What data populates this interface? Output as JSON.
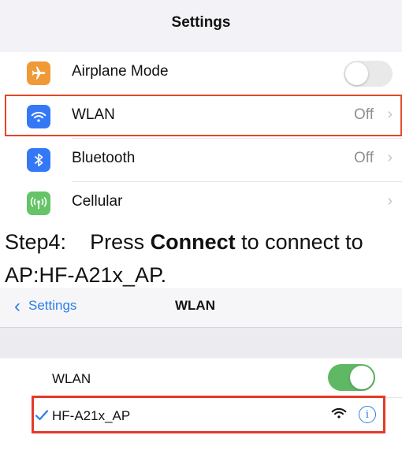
{
  "settings_screen": {
    "title": "Settings",
    "items": [
      {
        "label": "Airplane Mode",
        "icon": "airplane-icon",
        "icon_color": "#f09a37",
        "toggle_on": false
      },
      {
        "label": "WLAN",
        "icon": "wifi-icon",
        "icon_color": "#3478f6",
        "value": "Off"
      },
      {
        "label": "Bluetooth",
        "icon": "bluetooth-icon",
        "icon_color": "#3478f6",
        "value": "Off"
      },
      {
        "label": "Cellular",
        "icon": "cellular-icon",
        "icon_color": "#65c466"
      }
    ]
  },
  "caption": {
    "prefix": "Step4:    Press ",
    "bold": "Connect",
    "suffix": " to connect to",
    "line2": "AP:HF-A21x_AP."
  },
  "wlan_screen": {
    "back_label": "Settings",
    "title": "WLAN",
    "wlan_label": "WLAN",
    "wlan_toggle_on": true,
    "connected_network": "HF-A21x_AP",
    "info_glyph": "i"
  },
  "colors": {
    "accent_blue": "#2b7de9",
    "highlight_red": "#e5442a",
    "toggle_green": "#5fb864"
  }
}
